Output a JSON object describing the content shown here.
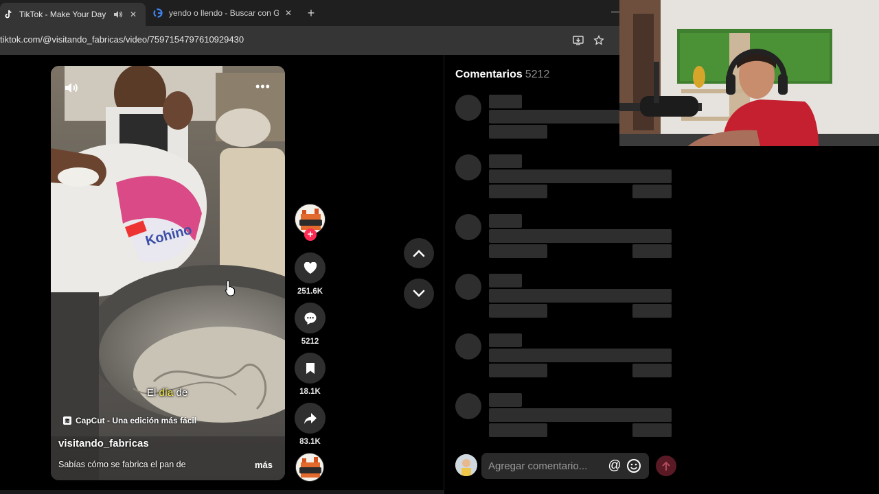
{
  "browser": {
    "tabs": [
      {
        "title": "TikTok - Make Your Day",
        "icon": "tiktok-icon",
        "active": true
      },
      {
        "title": "yendo o llendo - Buscar con Go",
        "icon": "google-icon",
        "active": false
      }
    ],
    "new_tab_label": "+",
    "url": "tiktok.com/@visitando_fabricas/video/7597154797610929430"
  },
  "video": {
    "caption_prefix": "El ",
    "caption_highlight": "día",
    "caption_suffix": " de",
    "capcut_label": "CapCut - Una edición más fácil",
    "author": "visitando_fabricas",
    "description": "Sabías cómo se fabrica el pan de",
    "more_label": "más",
    "more_dots": "•••"
  },
  "actions": {
    "follow_symbol": "+",
    "likes": "251.6K",
    "comments": "5212",
    "saves": "18.1K",
    "shares": "83.1K"
  },
  "comments_panel": {
    "title": "Comentarios",
    "count": "5212",
    "input_placeholder": "Agregar comentario...",
    "at_symbol": "@"
  },
  "colors": {
    "accent": "#fe2c55",
    "panel_bg": "#000000",
    "skeleton": "#2e2e2e",
    "highlight_word": "#f2e94e"
  }
}
